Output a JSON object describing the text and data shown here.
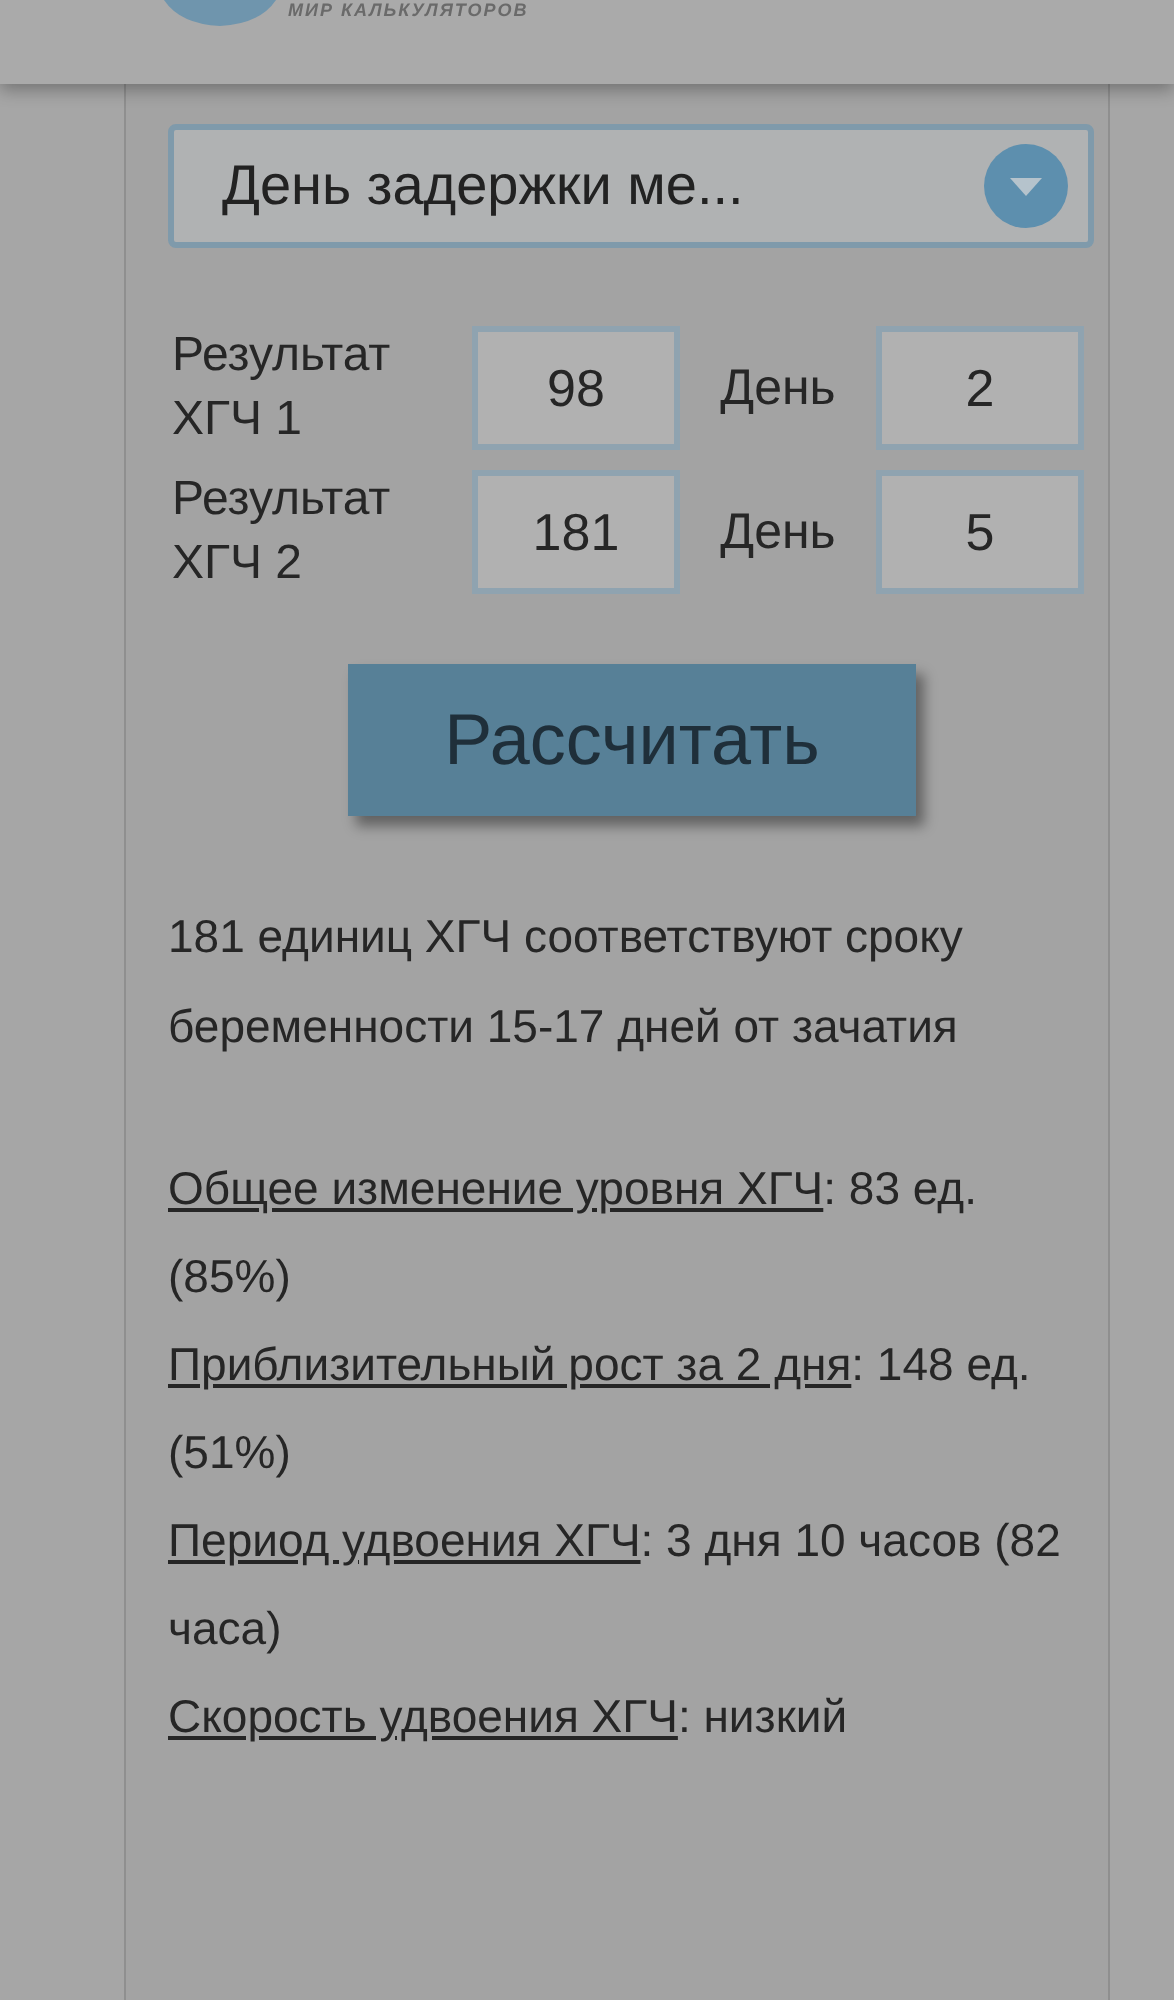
{
  "header": {
    "tagline": "МИР КАЛЬКУЛЯТОРОВ"
  },
  "dropdown": {
    "value": "День задержки ме..."
  },
  "inputs": [
    {
      "label": "Результат ХГЧ 1",
      "value": "98",
      "day_label": "День",
      "day_value": "2"
    },
    {
      "label": "Результат ХГЧ 2",
      "value": "181",
      "day_label": "День",
      "day_value": "5"
    }
  ],
  "button": {
    "label": "Рассчитать"
  },
  "summary": {
    "lines": [
      "181 единиц ХГЧ соответствуют сроку",
      "беременности 15-17 дней от зачатия"
    ]
  },
  "results": [
    {
      "term": "Общее изменение уровня ХГЧ",
      "value": ": 83 ед. (85%)"
    },
    {
      "term": "Приблизительный рост за 2 дня",
      "value": ": 148 ед. (51%)"
    },
    {
      "term": "Период удвоения ХГЧ",
      "value": ": 3 дня 10 часов (82 часа)"
    },
    {
      "term": "Скорость удвоения ХГЧ",
      "value": ": низкий"
    }
  ]
}
